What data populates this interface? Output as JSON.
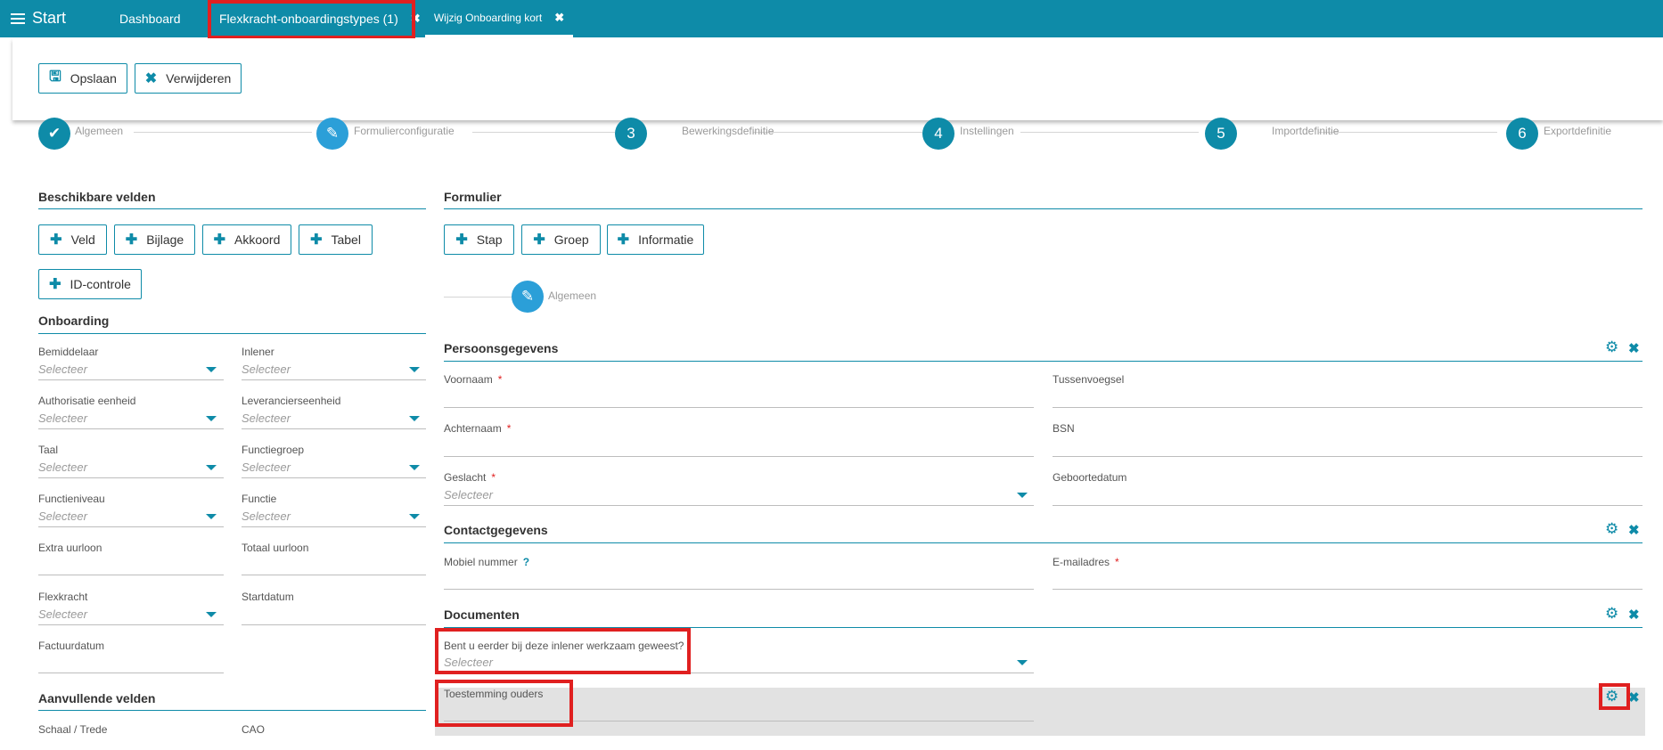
{
  "topbar": {
    "start_label": "Start",
    "tabs": [
      {
        "label": "Dashboard"
      },
      {
        "label": "Flexkracht-onboardingstypes (1)",
        "close": "✖"
      },
      {
        "label": "Wijzig Onboarding kort",
        "close": "✖"
      }
    ]
  },
  "toolbar": {
    "save_label": "Opslaan",
    "delete_label": "Verwijderen"
  },
  "steps": [
    {
      "num": "✔",
      "label": "Algemeen"
    },
    {
      "num": "✎",
      "label": "Formulierconfiguratie"
    },
    {
      "num": "3",
      "label": "Bewerkingsdefinitie"
    },
    {
      "num": "4",
      "label": "Instellingen"
    },
    {
      "num": "5",
      "label": "Importdefinitie"
    },
    {
      "num": "6",
      "label": "Exportdefinitie"
    }
  ],
  "left": {
    "title": "Beschikbare velden",
    "buttons": [
      "Veld",
      "Bijlage",
      "Akkoord",
      "Tabel",
      "ID-controle"
    ],
    "onboarding_title": "Onboarding",
    "fields": [
      {
        "label": "Bemiddelaar",
        "placeholder": "Selecteer"
      },
      {
        "label": "Inlener",
        "placeholder": "Selecteer"
      },
      {
        "label": "Authorisatie eenheid",
        "placeholder": "Selecteer"
      },
      {
        "label": "Leverancierseenheid",
        "placeholder": "Selecteer"
      },
      {
        "label": "Taal",
        "placeholder": "Selecteer"
      },
      {
        "label": "Functiegroep",
        "placeholder": "Selecteer"
      },
      {
        "label": "Functieniveau",
        "placeholder": "Selecteer"
      },
      {
        "label": "Functie",
        "placeholder": "Selecteer"
      },
      {
        "label": "Extra uurloon",
        "placeholder": ""
      },
      {
        "label": "Totaal uurloon",
        "placeholder": ""
      },
      {
        "label": "Flexkracht",
        "placeholder": "Selecteer"
      },
      {
        "label": "Startdatum",
        "placeholder": ""
      },
      {
        "label": "Factuurdatum",
        "placeholder": ""
      }
    ],
    "extra_title": "Aanvullende velden",
    "extra_fields": [
      {
        "label": "Schaal / Trede"
      },
      {
        "label": "CAO"
      }
    ]
  },
  "right": {
    "title": "Formulier",
    "buttons": [
      "Stap",
      "Groep",
      "Informatie"
    ],
    "step_label": "Algemeen",
    "groups": [
      {
        "title": "Persoonsgegevens",
        "fields": [
          {
            "label": "Voornaam",
            "required": "*"
          },
          {
            "label": "Tussenvoegsel"
          },
          {
            "label": "Achternaam",
            "required": "*"
          },
          {
            "label": "BSN"
          },
          {
            "label": "Geslacht",
            "required": "*",
            "placeholder": "Selecteer"
          },
          {
            "label": "Geboortedatum"
          }
        ]
      },
      {
        "title": "Contactgegevens",
        "fields": [
          {
            "label": "Mobiel nummer",
            "help": "?"
          },
          {
            "label": "E-mailadres",
            "required": "*"
          }
        ]
      },
      {
        "title": "Documenten",
        "fields": [
          {
            "label": "Bent u eerder bij deze inlener werkzaam geweest?",
            "placeholder": "Selecteer"
          },
          {
            "label": "Toestemming ouders"
          }
        ]
      }
    ]
  },
  "colors": {
    "accent": "#0e8ba8",
    "highlight": "#e02020",
    "required": "#e02020"
  },
  "icons": {
    "settings": "gears-icon",
    "close": "close-icon"
  }
}
